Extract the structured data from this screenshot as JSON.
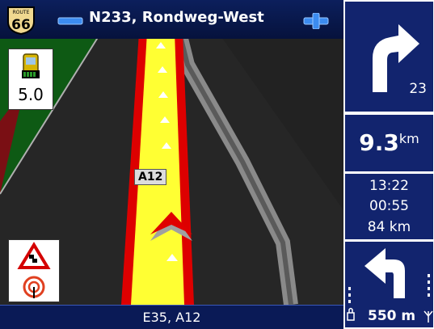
{
  "header": {
    "street_name": "N233, Rondweg-West",
    "route_shield_label": "ROUTE",
    "route_shield_number": "66"
  },
  "map": {
    "gps_accuracy": "5.0",
    "road_label": "A12"
  },
  "footer": {
    "road_name": "E35, A12"
  },
  "guidance": {
    "turn_road_number": "23",
    "distance_value": "9.3",
    "distance_unit": "km",
    "eta": "13:22",
    "remaining_time": "00:55",
    "remaining_distance": "84 km",
    "next_turn_distance": "550 m"
  },
  "colors": {
    "panel_blue": "#12246e",
    "route_yellow": "#ffff33",
    "route_red": "#dd0000"
  }
}
